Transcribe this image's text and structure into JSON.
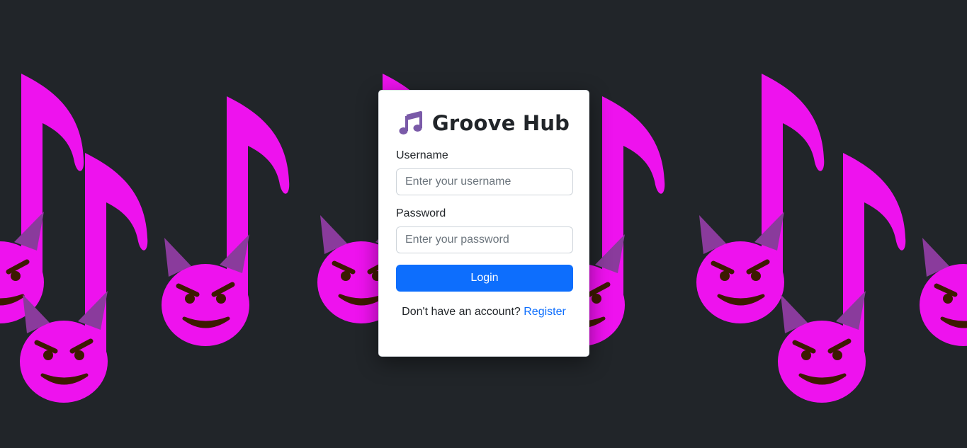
{
  "app": {
    "title": "Groove Hub",
    "icon": "musical-notes-icon"
  },
  "background": {
    "color": "#212529",
    "pattern_icon": "devil-music-note-icon",
    "pattern_colors": [
      "#ee12ee",
      "#8a3b9c",
      "#3d1a00"
    ]
  },
  "form": {
    "username_label": "Username",
    "username_placeholder": "Enter your username",
    "username_value": "",
    "password_label": "Password",
    "password_placeholder": "Enter your password",
    "password_value": "",
    "login_label": "Login",
    "register_prompt": "Don't have an account?",
    "register_link": "Register"
  },
  "colors": {
    "primary": "#0d6efd",
    "card": "#ffffff",
    "text": "#212529"
  }
}
